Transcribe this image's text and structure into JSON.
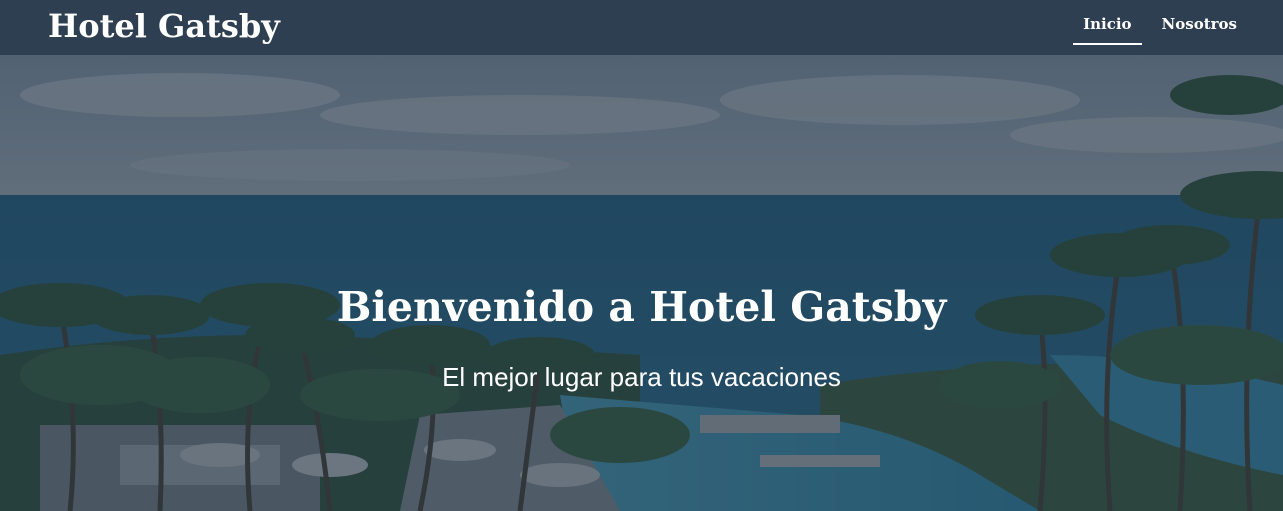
{
  "header": {
    "brand": "Hotel Gatsby",
    "nav": [
      {
        "label": "Inicio",
        "active": true
      },
      {
        "label": "Nosotros",
        "active": false
      }
    ]
  },
  "hero": {
    "title": "Bienvenido a Hotel Gatsby",
    "subtitle": "El mejor lugar para tus vacaciones",
    "background": "resort-pool-ocean-palms-photo"
  },
  "colors": {
    "header_bg": "#2f3f52",
    "overlay": "#22313f",
    "text": "#ffffff"
  }
}
